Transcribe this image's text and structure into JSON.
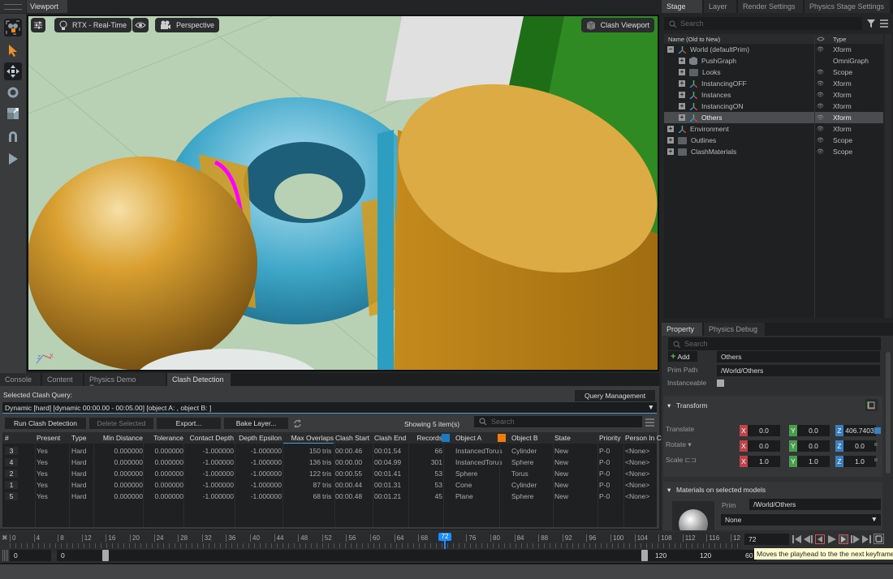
{
  "viewport": {
    "tab_label": "Viewport",
    "render_mode": "RTX - Real-Time",
    "camera": "Perspective",
    "clash_viewport_label": "Clash Viewport",
    "axis_labels": {
      "z": "Z",
      "x": "X"
    }
  },
  "left_toolbar": {
    "tools": [
      "select-tool",
      "move-tool",
      "rotate-tool",
      "scale-tool",
      "snap-tool",
      "play-tool"
    ]
  },
  "stage": {
    "tabs": [
      {
        "label": "Stage",
        "active": true
      },
      {
        "label": "Layer",
        "active": false
      },
      {
        "label": "Render Settings",
        "active": false
      },
      {
        "label": "Physics Stage Settings",
        "active": false
      }
    ],
    "search_placeholder": "Search",
    "columns": {
      "name": "Name (Old to New)",
      "type": "Type"
    },
    "tree": [
      {
        "label": "World (defaultPrim)",
        "type": "Xform",
        "icon": "xform",
        "depth": 0,
        "expanded": true,
        "visible": true,
        "selected": false
      },
      {
        "label": "PushGraph",
        "type": "OmniGraph",
        "icon": "cube",
        "depth": 1,
        "expanded": false,
        "visible": false,
        "selected": false
      },
      {
        "label": "Looks",
        "type": "Scope",
        "icon": "folder",
        "depth": 1,
        "expanded": false,
        "visible": true,
        "selected": false
      },
      {
        "label": "InstancingOFF",
        "type": "Xform",
        "icon": "xform",
        "depth": 1,
        "expanded": false,
        "visible": true,
        "selected": false
      },
      {
        "label": "Instances",
        "type": "Xform",
        "icon": "xform",
        "depth": 1,
        "expanded": false,
        "visible": true,
        "selected": false
      },
      {
        "label": "InstancingON",
        "type": "Xform",
        "icon": "xform",
        "depth": 1,
        "expanded": false,
        "visible": true,
        "selected": false
      },
      {
        "label": "Others",
        "type": "Xform",
        "icon": "xform",
        "depth": 1,
        "expanded": false,
        "visible": true,
        "selected": true
      },
      {
        "label": "Environment",
        "type": "Xform",
        "icon": "xform",
        "depth": 0,
        "expanded": false,
        "visible": true,
        "selected": false
      },
      {
        "label": "Outlines",
        "type": "Scope",
        "icon": "folder",
        "depth": 0,
        "expanded": false,
        "visible": true,
        "selected": false
      },
      {
        "label": "ClashMaterials",
        "type": "Scope",
        "icon": "folder",
        "depth": 0,
        "expanded": false,
        "visible": true,
        "selected": false
      }
    ]
  },
  "property": {
    "tabs": [
      {
        "label": "Property",
        "active": true
      },
      {
        "label": "Physics Debug",
        "active": false
      }
    ],
    "search_placeholder": "Search",
    "add_label": "Add",
    "name_value": "Others",
    "prim_path_label": "Prim Path",
    "prim_path_value": "/World/Others",
    "instanceable_label": "Instanceable",
    "transform_header": "Transform",
    "translate_label": "Translate",
    "rotate_label": "Rotate",
    "scale_label": "Scale",
    "translate": {
      "x": "0.0",
      "y": "0.0",
      "z": "406.7403"
    },
    "rotate": {
      "x": "0.0",
      "y": "0.0",
      "z": "0.0"
    },
    "scale": {
      "x": "1.0",
      "y": "1.0",
      "z": "1.0"
    },
    "materials_header": "Materials on selected models",
    "material_prim_label": "Prim",
    "material_prim_value": "/World/Others",
    "material_value": "None"
  },
  "bottom_tabs": [
    {
      "label": "Console",
      "active": false
    },
    {
      "label": "Content",
      "active": false
    },
    {
      "label": "Physics Demo Scenes",
      "active": false
    },
    {
      "label": "Clash Detection",
      "active": true
    }
  ],
  "clash": {
    "selected_query_label": "Selected Clash Query:",
    "query_management_label": "Query Management",
    "query_value": "Dynamic [hard] [dynamic 00:00.00 - 00:05.00] [object A: , object B: ]",
    "run_label": "Run Clash Detection",
    "delete_label": "Delete Selected",
    "export_label": "Export...",
    "bake_label": "Bake Layer...",
    "showing_label": "Showing 5 item(s)",
    "search_placeholder": "Search",
    "columns": [
      "#",
      "Present",
      "Type",
      "Min Distance",
      "Tolerance",
      "Contact Depth",
      "Depth Epsilon",
      "Max Overlaps",
      "Clash Start",
      "Clash End",
      "Records",
      "Object A",
      "Object B",
      "State",
      "Priority",
      "Person In C"
    ],
    "object_a_color": "#1a7bc0",
    "object_b_color": "#f07c0c",
    "rows": [
      {
        "id": "3",
        "present": "Yes",
        "type": "Hard",
        "min_distance": "0.000000",
        "tolerance": "0.000000",
        "contact_depth": "-1.000000",
        "depth_epsilon": "-1.000000",
        "max_overlaps": "150",
        "unit": "tris",
        "clash_start": "00:00.46",
        "clash_end": "00:01.54",
        "records": "66",
        "object_a": "InstancedTorus",
        "object_b": "Cylinder",
        "state": "New",
        "priority": "P-0",
        "person": "<None>"
      },
      {
        "id": "4",
        "present": "Yes",
        "type": "Hard",
        "min_distance": "0.000000",
        "tolerance": "0.000000",
        "contact_depth": "-1.000000",
        "depth_epsilon": "-1.000000",
        "max_overlaps": "136",
        "unit": "tris",
        "clash_start": "00:00.00",
        "clash_end": "00:04.99",
        "records": "301",
        "object_a": "InstancedTorus",
        "object_b": "Sphere",
        "state": "New",
        "priority": "P-0",
        "person": "<None>"
      },
      {
        "id": "2",
        "present": "Yes",
        "type": "Hard",
        "min_distance": "0.000000",
        "tolerance": "0.000000",
        "contact_depth": "-1.000000",
        "depth_epsilon": "-1.000000",
        "max_overlaps": "122",
        "unit": "tris",
        "clash_start": "00:00.55",
        "clash_end": "00:01.41",
        "records": "53",
        "object_a": "Sphere",
        "object_b": "Torus",
        "state": "New",
        "priority": "P-0",
        "person": "<None>"
      },
      {
        "id": "1",
        "present": "Yes",
        "type": "Hard",
        "min_distance": "0.000000",
        "tolerance": "0.000000",
        "contact_depth": "-1.000000",
        "depth_epsilon": "-1.000000",
        "max_overlaps": "87",
        "unit": "tris",
        "clash_start": "00:00.44",
        "clash_end": "00:01.31",
        "records": "53",
        "object_a": "Cone",
        "object_b": "Cylinder",
        "state": "New",
        "priority": "P-0",
        "person": "<None>"
      },
      {
        "id": "5",
        "present": "Yes",
        "type": "Hard",
        "min_distance": "0.000000",
        "tolerance": "0.000000",
        "contact_depth": "-1.000000",
        "depth_epsilon": "-1.000000",
        "max_overlaps": "68",
        "unit": "tris",
        "clash_start": "00:00.48",
        "clash_end": "00:01.21",
        "records": "45",
        "object_a": "Plane",
        "object_b": "Sphere",
        "state": "New",
        "priority": "P-0",
        "person": "<None>"
      }
    ]
  },
  "timeline": {
    "ticks": [
      "0",
      "4",
      "8",
      "12",
      "16",
      "20",
      "24",
      "28",
      "32",
      "36",
      "40",
      "44",
      "48",
      "52",
      "56",
      "60",
      "64",
      "68",
      "72",
      "76",
      "80",
      "84",
      "88",
      "92",
      "96",
      "100",
      "104",
      "108",
      "112",
      "116",
      "12"
    ],
    "playhead": "72",
    "current_frame": "72",
    "start_value": "0",
    "range_start": "0",
    "range_end": "120",
    "end_value": "120",
    "fps_partial": "60",
    "tooltip": "Moves the playhead to the the next keyframe"
  }
}
